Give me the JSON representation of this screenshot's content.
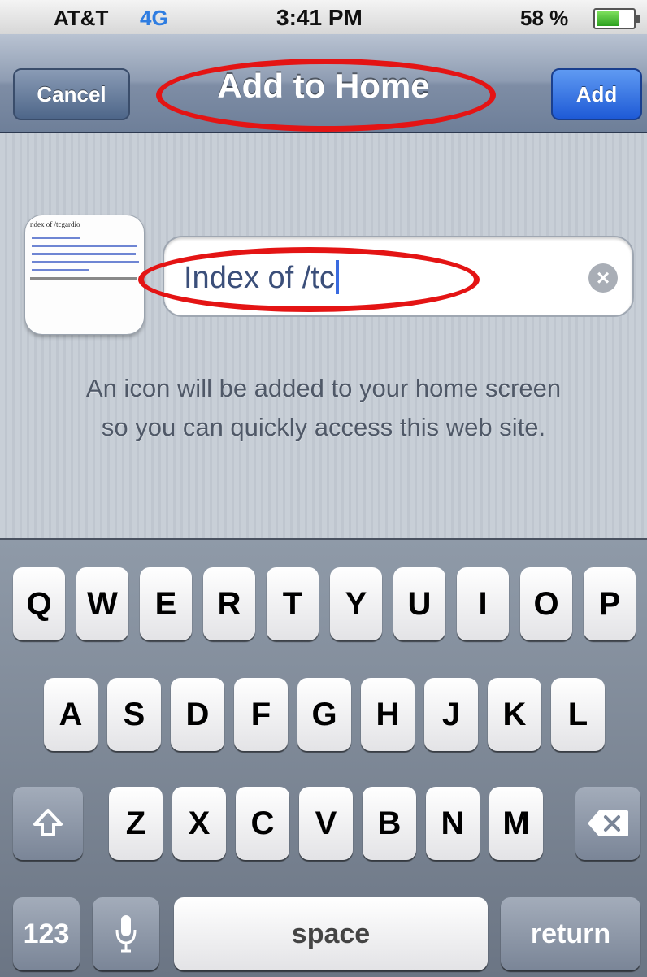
{
  "status_bar": {
    "carrier": "AT&T",
    "network": "4G",
    "time": "3:41 PM",
    "battery_percent": "58 %",
    "battery_level": 0.58
  },
  "nav": {
    "cancel_label": "Cancel",
    "title": "Add to Home",
    "add_label": "Add"
  },
  "form": {
    "name_value": "Index of /tc",
    "thumbnail_title": "ndex of /tcgardio"
  },
  "info_text": {
    "line1": "An icon will be added to your home screen",
    "line2": "so you can quickly access this web site."
  },
  "keyboard": {
    "row1": [
      "Q",
      "W",
      "E",
      "R",
      "T",
      "Y",
      "U",
      "I",
      "O",
      "P"
    ],
    "row2": [
      "A",
      "S",
      "D",
      "F",
      "G",
      "H",
      "J",
      "K",
      "L"
    ],
    "row3": [
      "Z",
      "X",
      "C",
      "V",
      "B",
      "N",
      "M"
    ],
    "shift_icon": "shift-arrow-icon",
    "delete_icon": "backspace-icon",
    "numbers_label": "123",
    "mic_icon": "microphone-icon",
    "space_label": "space",
    "return_label": "return"
  },
  "annotation_color": "#e41414"
}
